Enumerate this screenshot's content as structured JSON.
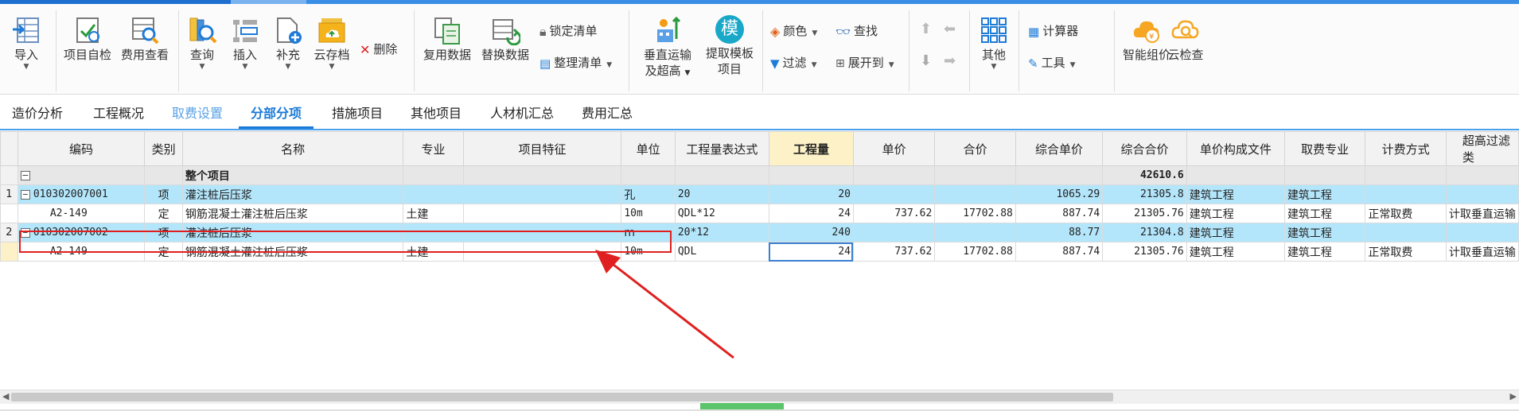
{
  "ribbon": {
    "import": "导入",
    "self_check": "项目自检",
    "fee_view": "费用查看",
    "query": "查询",
    "insert": "插入",
    "supplement": "补充",
    "cloud_save": "云存档",
    "delete": "删除",
    "reuse_data": "复用数据",
    "replace_data": "替换数据",
    "lock_list": "锁定清单",
    "organize_list": "整理清单",
    "vertical_transport_line1": "垂直运输",
    "vertical_transport_line2": "及超高",
    "extract_template_line1": "提取模板",
    "extract_template_line2": "项目",
    "template_glyph": "模",
    "color": "颜色",
    "find": "查找",
    "filter": "过滤",
    "expand_to": "展开到",
    "other": "其他",
    "calculator": "计算器",
    "tools": "工具",
    "smart_price": "智能组价",
    "cloud_check": "云检查"
  },
  "tabs": [
    "造价分析",
    "工程概况",
    "取费设置",
    "分部分项",
    "措施项目",
    "其他项目",
    "人材机汇总",
    "费用汇总"
  ],
  "table": {
    "headers": [
      "编码",
      "类别",
      "名称",
      "专业",
      "项目特征",
      "单位",
      "工程量表达式",
      "工程量",
      "单价",
      "合价",
      "综合单价",
      "综合合价",
      "单价构成文件",
      "取费专业",
      "计费方式",
      "超高过滤类"
    ],
    "whole": {
      "box": "−",
      "name": "整个项目",
      "total": "42610.6"
    },
    "rows": [
      {
        "rn": "1",
        "box": "−",
        "code": "010302007001",
        "type": "项",
        "name": "灌注桩后压浆",
        "major": "",
        "unit": "孔",
        "expr": "20",
        "qty": "20",
        "price": "",
        "amount": "",
        "unit_price": "1065.29",
        "total": "21305.8",
        "file": "建筑工程",
        "fee_major": "建筑工程",
        "method": "",
        "filter": ""
      },
      {
        "rn": "",
        "box": "",
        "code": "A2-149",
        "type": "定",
        "name": "钢筋混凝土灌注桩后压浆",
        "major": "土建",
        "unit": "10m",
        "expr": "QDL*12",
        "qty": "24",
        "price": "737.62",
        "amount": "17702.88",
        "unit_price": "887.74",
        "total": "21305.76",
        "file": "建筑工程",
        "fee_major": "建筑工程",
        "method": "正常取费",
        "filter": "计取垂直运输"
      },
      {
        "rn": "2",
        "box": "−",
        "code": "010302007002",
        "type": "项",
        "name": "灌注桩后压浆",
        "major": "",
        "unit": "m",
        "expr": "20*12",
        "qty": "240",
        "price": "",
        "amount": "",
        "unit_price": "88.77",
        "total": "21304.8",
        "file": "建筑工程",
        "fee_major": "建筑工程",
        "method": "",
        "filter": ""
      },
      {
        "rn": "",
        "box": "",
        "code": "A2-149",
        "type": "定",
        "name": "钢筋混凝土灌注桩后压浆",
        "major": "土建",
        "unit": "10m",
        "expr": "QDL",
        "qty": "24",
        "price": "737.62",
        "amount": "17702.88",
        "unit_price": "887.74",
        "total": "21305.76",
        "file": "建筑工程",
        "fee_major": "建筑工程",
        "method": "正常取费",
        "filter": "计取垂直运输"
      }
    ]
  },
  "scroll": {
    "left_arrow": "◀",
    "right_arrow": "▶"
  }
}
